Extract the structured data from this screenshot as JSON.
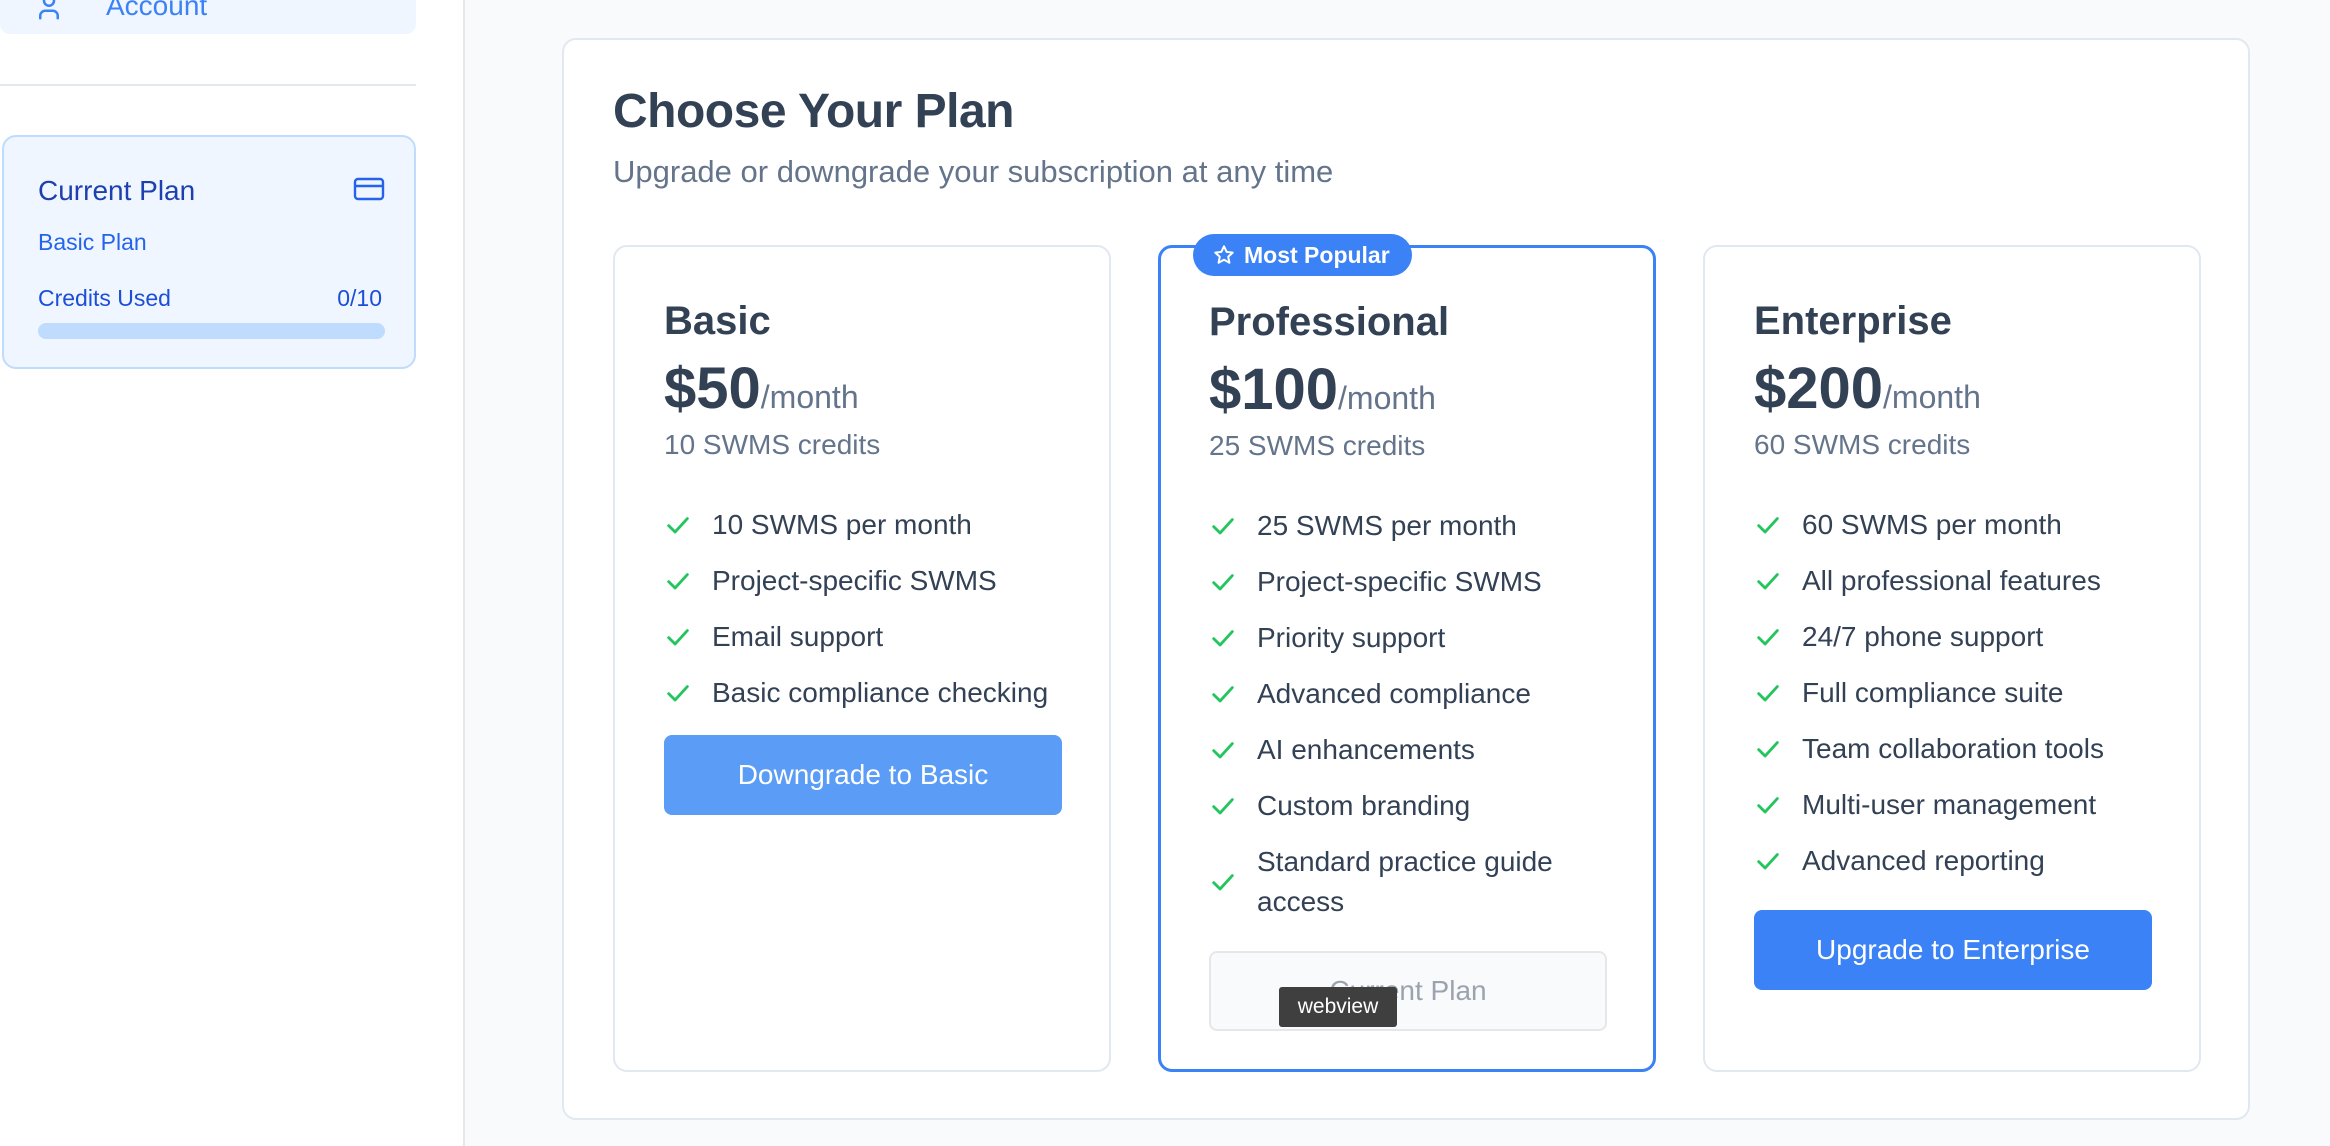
{
  "sidebar": {
    "nav_account_label": "Account",
    "current_plan": {
      "title": "Current Plan",
      "plan_name": "Basic Plan",
      "credits_label": "Credits Used",
      "credits_value": "0/10",
      "credits_progress": 0
    }
  },
  "main": {
    "title": "Choose Your Plan",
    "subtitle": "Upgrade or downgrade your subscription at any time",
    "plans": [
      {
        "name": "Basic",
        "price": "$50",
        "period": "/month",
        "credits": "10 SWMS credits",
        "features": [
          "10 SWMS per month",
          "Project-specific SWMS",
          "Email support",
          "Basic compliance checking"
        ],
        "button_label": "Downgrade to Basic"
      },
      {
        "name": "Professional",
        "badge": "Most Popular",
        "price": "$100",
        "period": "/month",
        "credits": "25 SWMS credits",
        "features": [
          "25 SWMS per month",
          "Project-specific SWMS",
          "Priority support",
          "Advanced compliance",
          "AI enhancements",
          "Custom branding",
          "Standard practice guide access"
        ],
        "button_label": "Current Plan"
      },
      {
        "name": "Enterprise",
        "price": "$200",
        "period": "/month",
        "credits": "60 SWMS credits",
        "features": [
          "60 SWMS per month",
          "All professional features",
          "24/7 phone support",
          "Full compliance suite",
          "Team collaboration tools",
          "Multi-user management",
          "Advanced reporting"
        ],
        "button_label": "Upgrade to Enterprise"
      }
    ]
  },
  "tooltip": "webview",
  "colors": {
    "accent": "#3b82f6",
    "check": "#22c55e"
  }
}
